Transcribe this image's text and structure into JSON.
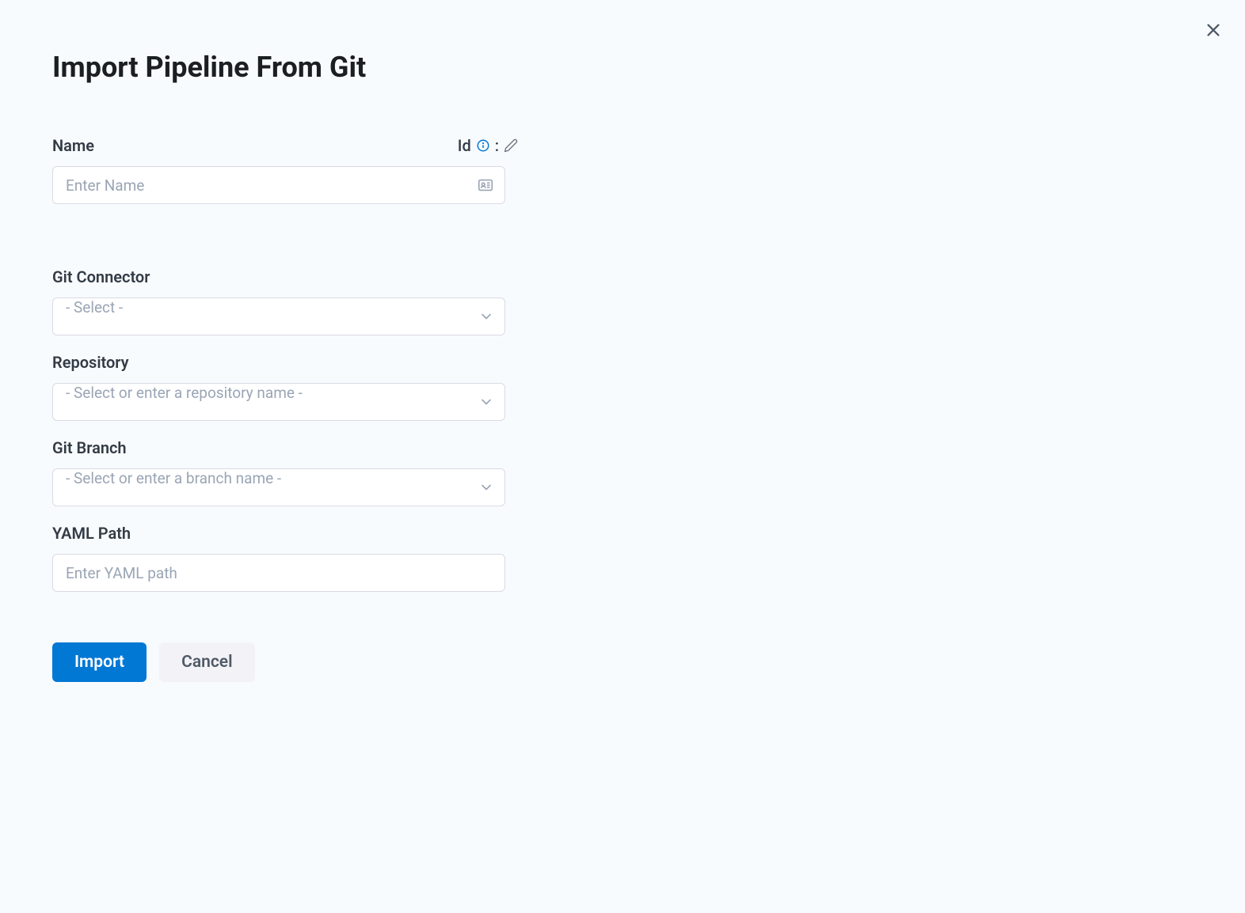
{
  "header": {
    "title": "Import Pipeline From Git"
  },
  "fields": {
    "name": {
      "label": "Name",
      "placeholder": "Enter Name",
      "value": "",
      "id_label": "Id",
      "id_colon": ":"
    },
    "git_connector": {
      "label": "Git Connector",
      "placeholder": "- Select -"
    },
    "repository": {
      "label": "Repository",
      "placeholder": "- Select or enter a repository name -"
    },
    "git_branch": {
      "label": "Git Branch",
      "placeholder": "- Select or enter a branch name -"
    },
    "yaml_path": {
      "label": "YAML Path",
      "placeholder": "Enter YAML path",
      "value": ""
    }
  },
  "buttons": {
    "import": "Import",
    "cancel": "Cancel"
  }
}
